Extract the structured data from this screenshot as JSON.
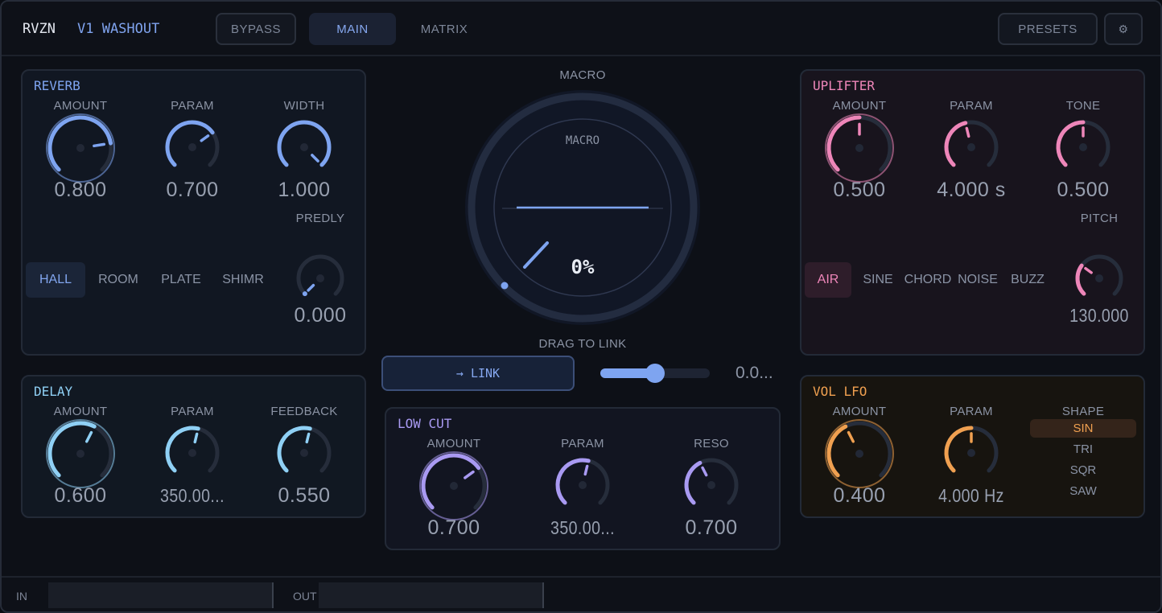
{
  "header": {
    "brand": "RVZN",
    "preset_name": "V1 WASHOUT",
    "bypass_label": "BYPASS",
    "tab_main": "MAIN",
    "tab_matrix": "MATRIX",
    "presets_label": "PRESETS",
    "settings_icon": "⚙"
  },
  "reverb": {
    "title": "REVERB",
    "color": "#7ea4f0",
    "amount_label": "AMOUNT",
    "amount_value": "0.800",
    "amount_level": 0.8,
    "param_label": "PARAM",
    "param_value": "0.700",
    "param_level": 0.7,
    "width_label": "WIDTH",
    "width_value": "1.000",
    "width_level": 1.0,
    "predly_label": "PREDLY",
    "predly_value": "0.000",
    "predly_level": 0.0,
    "types": [
      "HALL",
      "ROOM",
      "PLATE",
      "SHIMR"
    ],
    "selected_type": "HALL"
  },
  "delay": {
    "title": "DELAY",
    "color": "#8fd0f5",
    "amount_label": "AMOUNT",
    "amount_value": "0.600",
    "amount_level": 0.6,
    "param_label": "PARAM",
    "param_value": "350.00...",
    "param_level": 0.55,
    "feedback_label": "FEEDBACK",
    "feedback_value": "0.550",
    "feedback_level": 0.55
  },
  "macro": {
    "label": "MACRO",
    "inner_label": "MACRO",
    "value": "0%",
    "level": 0.0,
    "drag_hint": "DRAG TO LINK",
    "link_label": "→ LINK",
    "slider_value": "0.0...",
    "slider_level": 0.5
  },
  "low_cut": {
    "title": "LOW CUT",
    "color": "#a99af2",
    "amount_label": "AMOUNT",
    "amount_value": "0.700",
    "amount_level": 0.7,
    "param_label": "PARAM",
    "param_value": "350.00...",
    "param_level": 0.55,
    "reso_label": "RESO",
    "reso_value": "0.700",
    "reso_level": 0.4
  },
  "uplifter": {
    "title": "UPLIFTER",
    "color": "#ee86b9",
    "amount_label": "AMOUNT",
    "amount_value": "0.500",
    "amount_level": 0.5,
    "param_label": "PARAM",
    "param_value": "4.000 s",
    "param_level": 0.45,
    "tone_label": "TONE",
    "tone_value": "0.500",
    "tone_level": 0.5,
    "pitch_label": "PITCH",
    "pitch_value": "130.000",
    "pitch_level": 0.3,
    "types": [
      "AIR",
      "SINE",
      "CHORD",
      "NOISE",
      "BUZZ"
    ],
    "selected_type": "AIR"
  },
  "vol_lfo": {
    "title": "VOL LFO",
    "color": "#f0a050",
    "amount_label": "AMOUNT",
    "amount_value": "0.400",
    "amount_level": 0.4,
    "param_label": "PARAM",
    "param_value": "4.000 Hz",
    "param_level": 0.5,
    "shape_label": "SHAPE",
    "shapes": [
      "SIN",
      "TRI",
      "SQR",
      "SAW"
    ],
    "selected_shape": "SIN"
  },
  "io": {
    "in_label": "IN",
    "out_label": "OUT"
  }
}
